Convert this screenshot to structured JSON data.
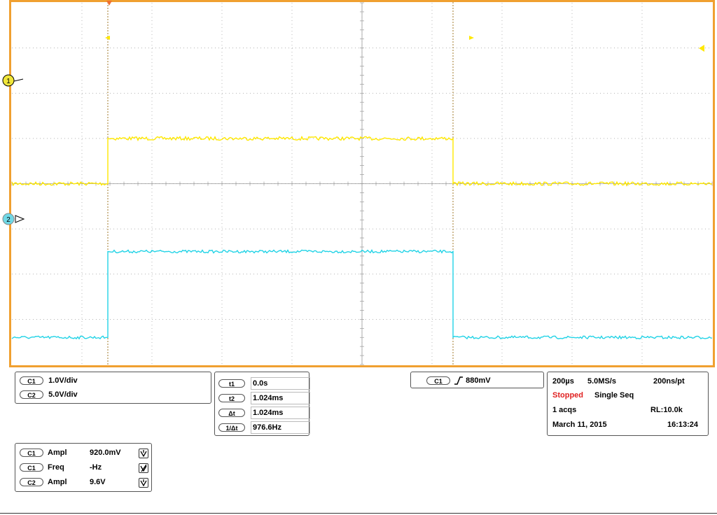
{
  "scope": {
    "colors": {
      "frame": "#f0a030",
      "grid": "#9a9a9a",
      "ch1": "#ffe800",
      "ch2": "#22d3e6",
      "ch1_marker_fill": "#f0e63a",
      "ch2_marker_fill": "#6fd8e6"
    },
    "ch1_marker": "1",
    "ch2_marker": "2",
    "divisions": {
      "x": 10,
      "y": 8
    },
    "traces": {
      "ch1": {
        "low_level_div": 4.0,
        "high_level_div": 5.0,
        "rise_div": 1.37,
        "fall_div": 6.3
      },
      "ch2": {
        "low_level_div": 0.6,
        "high_level_div": 2.5,
        "rise_div": 1.37,
        "fall_div": 6.3
      }
    }
  },
  "channels_panel": {
    "rows": [
      {
        "ch": "C1",
        "scale": "1.0V/div"
      },
      {
        "ch": "C2",
        "scale": "5.0V/div"
      }
    ]
  },
  "cursors_panel": {
    "rows": [
      {
        "label": "t1",
        "value": "0.0s"
      },
      {
        "label": "t2",
        "value": "1.024ms"
      },
      {
        "label": "Δt",
        "value": "1.024ms"
      },
      {
        "label": "1/Δt",
        "value": "976.6Hz"
      }
    ]
  },
  "trigger_panel": {
    "ch": "C1",
    "level": "880mV"
  },
  "acq_panel": {
    "timebase": "200µs",
    "sample_rate": "5.0MS/s",
    "resolution": "200ns/pt",
    "state": "Stopped",
    "mode": "Single Seq",
    "acqs": "1 acqs",
    "record_length": "RL:10.0k",
    "date": "March 11, 2015",
    "time": "16:13:24",
    "state_color": "#e02020"
  },
  "measure_panel": {
    "rows": [
      {
        "ch": "C1",
        "name": "Ampl",
        "value": "920.0mV",
        "status": "ok"
      },
      {
        "ch": "C1",
        "name": "Freq",
        "value": "-Hz",
        "status": "error"
      },
      {
        "ch": "C2",
        "name": "Ampl",
        "value": "9.6V",
        "status": "ok"
      }
    ]
  }
}
